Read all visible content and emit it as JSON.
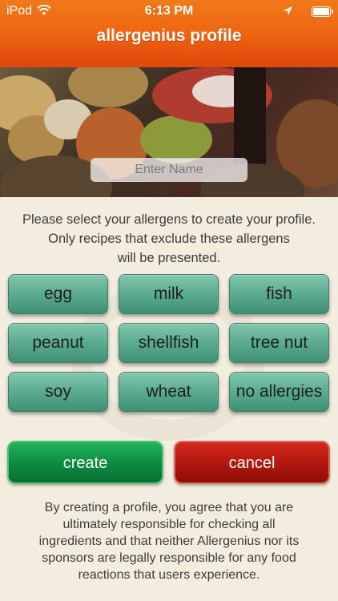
{
  "status_bar": {
    "carrier": "iPod",
    "time": "6:13 PM"
  },
  "header": {
    "title": "allergenius profile"
  },
  "name_input": {
    "placeholder": "Enter Name",
    "value": ""
  },
  "instructions": [
    "Please select your allergens to create your profile.",
    "Only recipes that exclude these allergens",
    "will be presented."
  ],
  "allergens": [
    "egg",
    "milk",
    "fish",
    "peanut",
    "shellfish",
    "tree nut",
    "soy",
    "wheat",
    "no allergies"
  ],
  "actions": {
    "create_label": "create",
    "cancel_label": "cancel"
  },
  "disclaimer": [
    "By creating a profile, you agree that you are",
    "ultimately responsible for checking all",
    "ingredients and that neither Allergenius nor its",
    "sponsors are legally responsible for any food",
    "reactions that users experience."
  ],
  "colors": {
    "header": "#ee6612",
    "allergen_button": "#5fae92",
    "create_button": "#0c8a3f",
    "cancel_button": "#b0170f",
    "background": "#f3ede0"
  },
  "icons": [
    "wifi-icon",
    "location-arrow-icon",
    "battery-icon"
  ]
}
